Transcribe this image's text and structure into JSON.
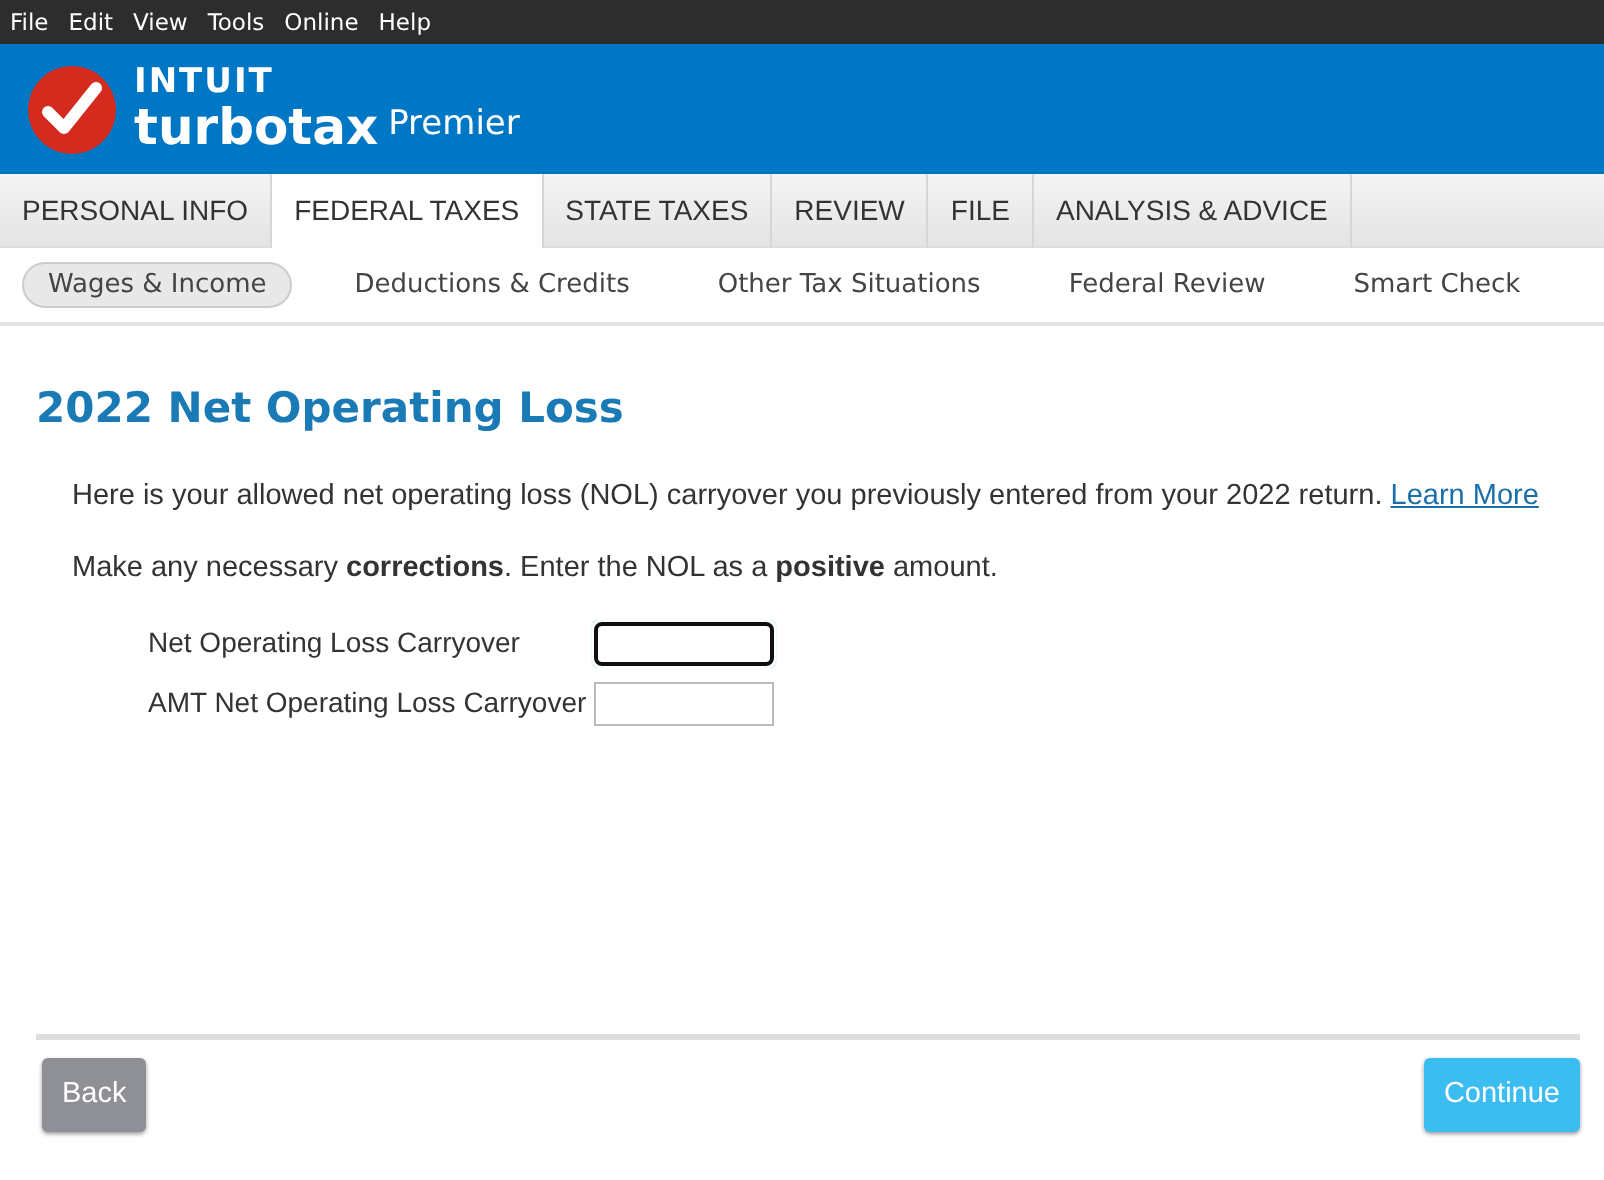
{
  "menu": [
    "File",
    "Edit",
    "View",
    "Tools",
    "Online",
    "Help"
  ],
  "brand": {
    "company": "INTUIT",
    "product": "turbotax",
    "edition": "Premier"
  },
  "tabs": [
    {
      "label": "PERSONAL INFO",
      "selected": false
    },
    {
      "label": "FEDERAL TAXES",
      "selected": true
    },
    {
      "label": "STATE TAXES",
      "selected": false
    },
    {
      "label": "REVIEW",
      "selected": false
    },
    {
      "label": "FILE",
      "selected": false
    },
    {
      "label": "ANALYSIS & ADVICE",
      "selected": false
    }
  ],
  "subtabs": [
    {
      "label": "Wages & Income",
      "selected": true
    },
    {
      "label": "Deductions & Credits",
      "selected": false
    },
    {
      "label": "Other Tax Situations",
      "selected": false
    },
    {
      "label": "Federal Review",
      "selected": false
    },
    {
      "label": "Smart Check",
      "selected": false
    }
  ],
  "title": "2022 Net Operating Loss",
  "intro": {
    "text": "Here is your allowed net operating loss (NOL) carryover you previously entered from your 2022 return.",
    "link": "Learn More"
  },
  "instruction": "Make any necessary **corrections**. Enter the NOL as a **positive** amount.",
  "fields": [
    {
      "label": "Net Operating Loss Carryover",
      "focused": true
    },
    {
      "label": "AMT Net Operating Loss Carryover",
      "focused": false
    }
  ],
  "buttons": {
    "back": "Back",
    "continue": "Continue"
  }
}
